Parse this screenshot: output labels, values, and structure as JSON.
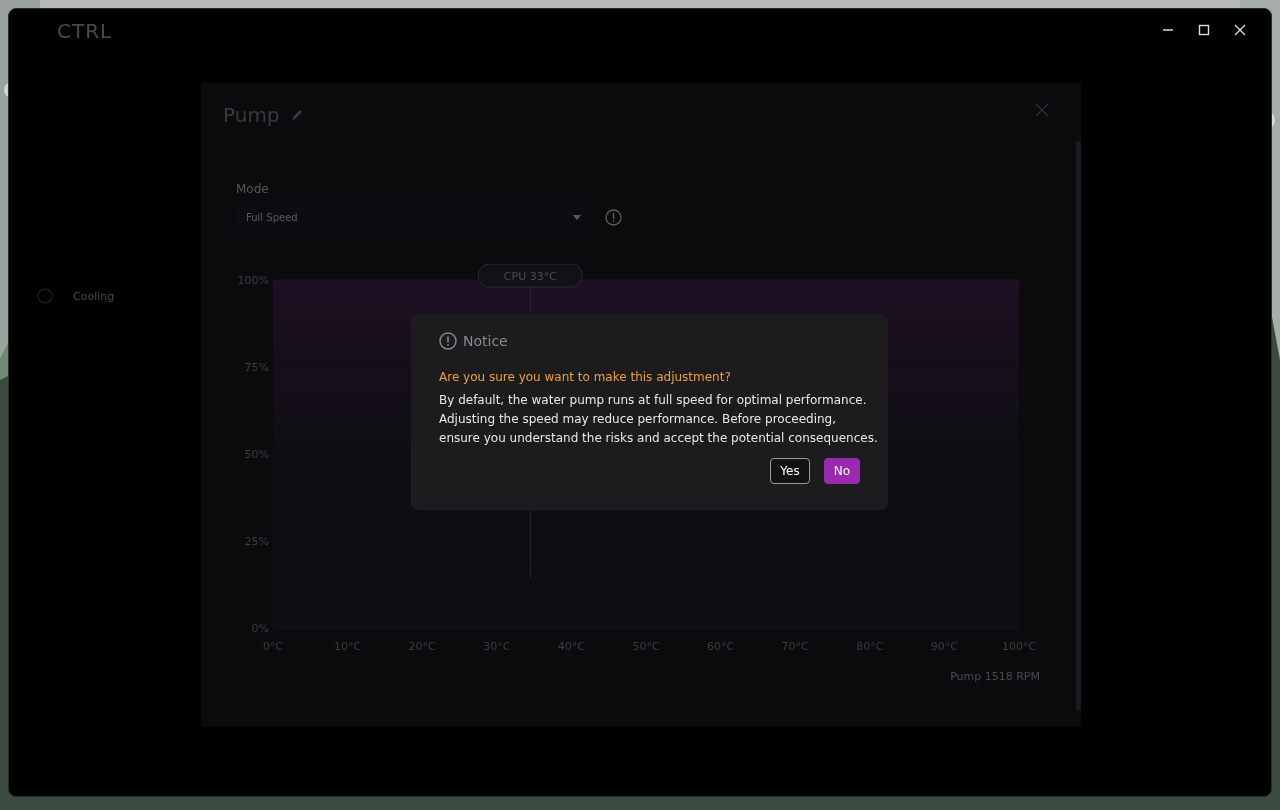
{
  "app": {
    "logo": "CTRL",
    "nav": [
      {
        "label": "Cooling"
      }
    ]
  },
  "panel": {
    "title": "Pump",
    "mode": {
      "label": "Mode",
      "value": "Full Speed"
    },
    "chart_data": {
      "type": "area",
      "x": [
        0,
        100
      ],
      "series": [
        {
          "color": "#5a1f6e",
          "values": [
            100,
            100
          ]
        }
      ],
      "xlim": [
        0,
        100
      ],
      "ylim": [
        0,
        100
      ],
      "xticks": [
        {
          "value": 0,
          "label": "0°C"
        },
        {
          "value": 10,
          "label": "10°C"
        },
        {
          "value": 20,
          "label": "20°C"
        },
        {
          "value": 30,
          "label": "30°C"
        },
        {
          "value": 40,
          "label": "40°C"
        },
        {
          "value": 50,
          "label": "50°C"
        },
        {
          "value": 60,
          "label": "60°C"
        },
        {
          "value": 70,
          "label": "70°C"
        },
        {
          "value": 80,
          "label": "80°C"
        },
        {
          "value": 90,
          "label": "90°C"
        },
        {
          "value": 100,
          "label": "100°C"
        }
      ],
      "yticks": [
        {
          "value": 0,
          "label": "0%"
        },
        {
          "value": 25,
          "label": "25%"
        },
        {
          "value": 50,
          "label": "50%"
        },
        {
          "value": 75,
          "label": "75%"
        },
        {
          "value": 100,
          "label": "100%"
        }
      ],
      "annotations": [
        "CPU 33°C"
      ],
      "ref_lines": [
        {
          "axis": "x",
          "value": 34.5
        }
      ]
    },
    "footer": "Pump 1518 RPM"
  },
  "dialog": {
    "title": "Notice",
    "question": "Are you sure you want to make this adjustment?",
    "message": "By default, the water pump runs at full speed for optimal performance. Adjusting the speed may reduce performance. Before proceeding, ensure you understand the risks and accept the potential consequences.",
    "buttons": [
      {
        "label": "Yes",
        "kind": "outline"
      },
      {
        "label": "No",
        "kind": "primary"
      }
    ]
  }
}
